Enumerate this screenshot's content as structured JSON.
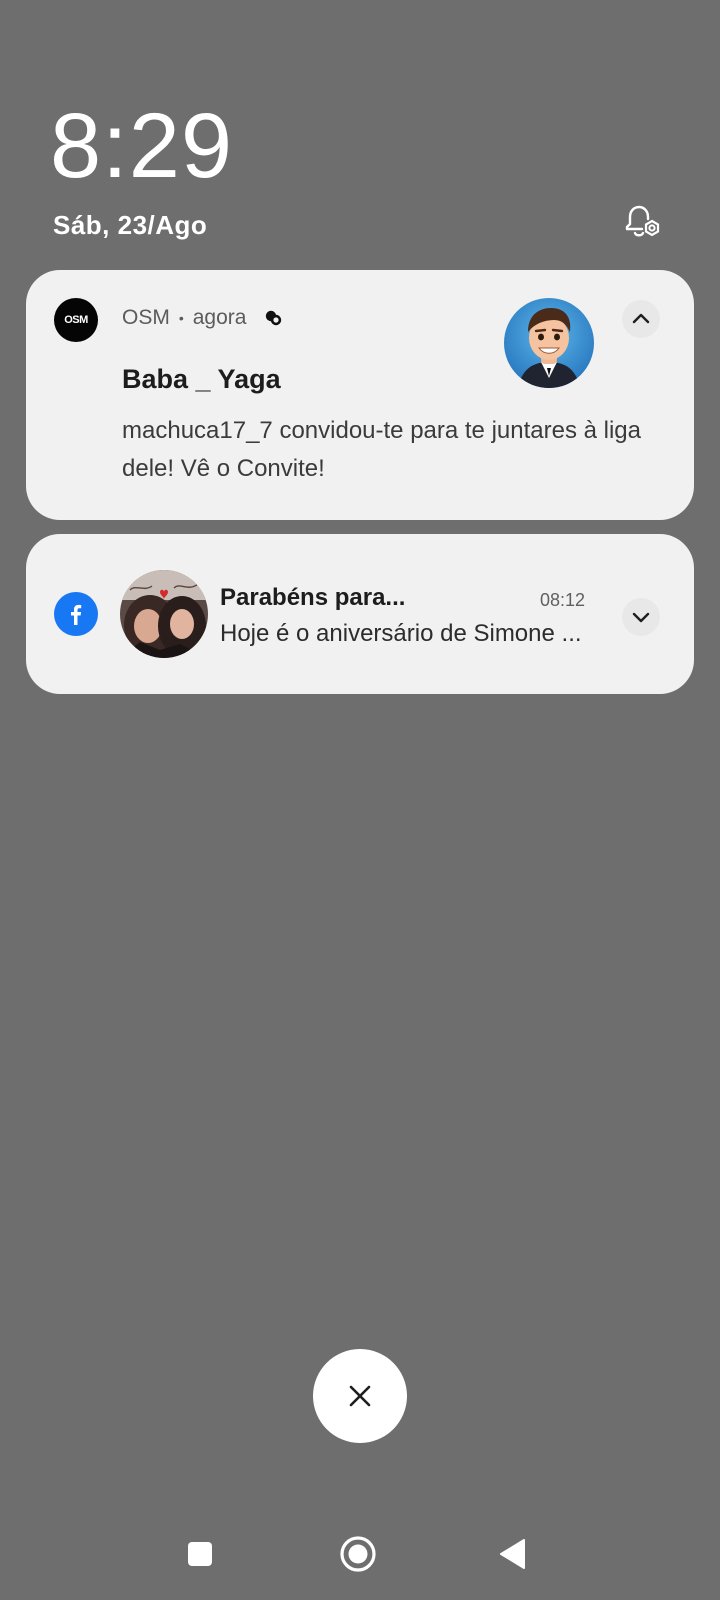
{
  "lockscreen": {
    "time": "8:29",
    "date": "Sáb, 23/Ago"
  },
  "notifications": [
    {
      "app_name": "OSM",
      "app_icon_text": "OSM",
      "when": "agora",
      "separator": "•",
      "title": "Baba _ Yaga",
      "body": "machuca17_7 convidou-te para te juntares à liga dele! Vê o Convite!",
      "expanded": true
    },
    {
      "app_name": "Facebook",
      "title": "Parabéns para...",
      "time": "08:12",
      "body": "Hoje é o aniversário de Simone ...",
      "expanded": false
    }
  ],
  "colors": {
    "background": "#6e6e6e",
    "card": "#f1f1f1",
    "facebook_blue": "#1877f2"
  },
  "icons": {
    "settings": "notification-settings-icon",
    "collapse": "chevron-up-icon",
    "expand": "chevron-down-icon",
    "clear": "close-icon",
    "recents": "square-icon",
    "home": "circle-icon",
    "back": "triangle-back-icon"
  }
}
